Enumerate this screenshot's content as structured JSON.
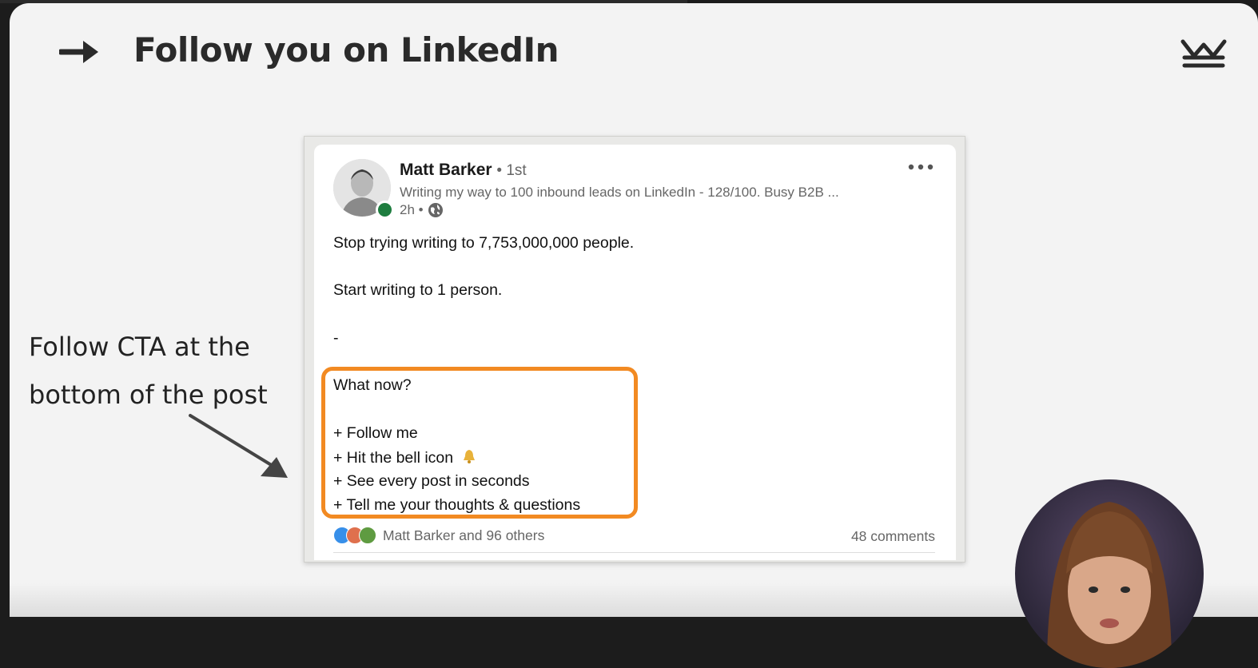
{
  "slide": {
    "title": "Follow you on LinkedIn",
    "annotation_lines": [
      "Follow CTA at the",
      "bottom of the post"
    ]
  },
  "post": {
    "author": "Matt Barker",
    "degree": "• 1st",
    "headline": "Writing my way to 100 inbound leads on LinkedIn - 128/100. Busy B2B ...",
    "time": "2h •",
    "body": [
      "Stop trying writing to 7,753,000,000 people.",
      "Start writing to 1 person.",
      "-",
      "What now?",
      "+ Follow me",
      "+ Hit the bell icon",
      "+ See every post in seconds",
      "+ Tell me your thoughts & questions"
    ],
    "reactions_text": "Matt Barker and 96 others",
    "comments": "48 comments"
  },
  "colors": {
    "highlight": "#f28a22",
    "online": "#1e7d3f",
    "title_text": "#2a2a2a"
  },
  "icons": [
    "arrow-right-icon",
    "crown-logo-icon",
    "more-options-icon",
    "globe-icon",
    "bell-icon",
    "like-reaction-icon",
    "love-reaction-icon",
    "support-reaction-icon"
  ]
}
